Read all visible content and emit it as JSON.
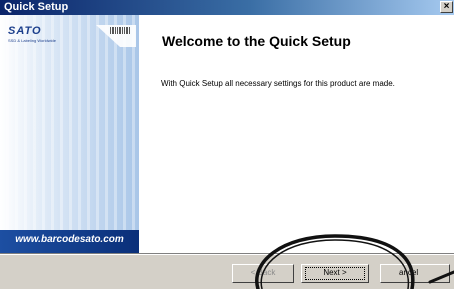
{
  "window": {
    "title": "Quick Setup",
    "close_label": "×"
  },
  "banner": {
    "logo": "SATO",
    "logo_sub": "SSD & Labeling Worldwide",
    "url": "www.barcodesato.com"
  },
  "content": {
    "title": "Welcome to the Quick Setup",
    "body": "With Quick Setup all necessary settings for this product are made."
  },
  "buttons": {
    "back": "< Back",
    "next": "Next >",
    "cancel": "ancel"
  },
  "colors": {
    "titlebar_start": "#0a246a",
    "banner_accent": "#1d4fa2",
    "dialog_face": "#d4d0c8"
  }
}
